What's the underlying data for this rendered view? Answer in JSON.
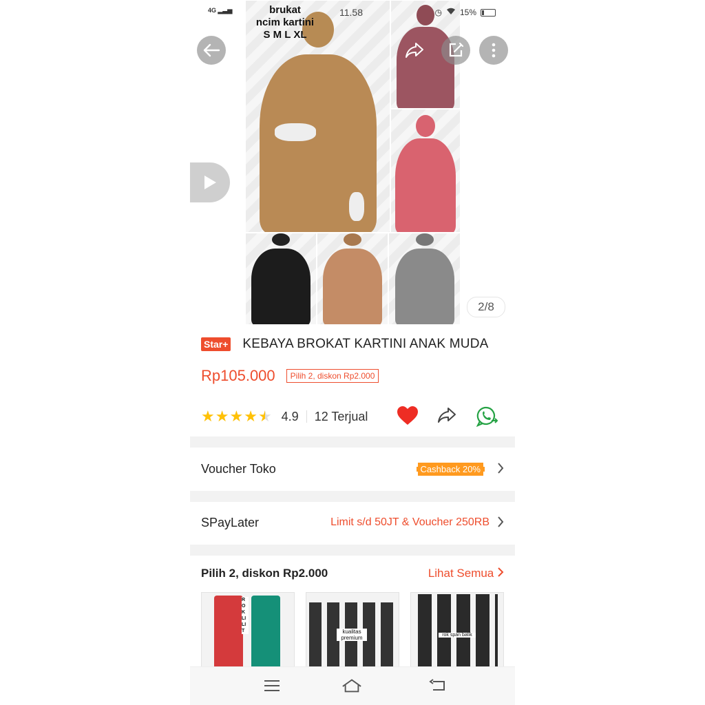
{
  "status_bar": {
    "network": "4G",
    "time": "11.58",
    "battery": "15%"
  },
  "hero": {
    "overlay_text_line1": "brukat",
    "overlay_text_line2": "ncim kartini",
    "overlay_text_line3": "S M L XL",
    "page_counter": "2/8"
  },
  "product": {
    "badge": "Star+",
    "title": "KEBAYA BROKAT KARTINI ANAK MUDA",
    "price": "Rp105.000",
    "promo_tag": "Pilih 2, diskon Rp2.000",
    "rating": "4.9",
    "rating_stars": 4.5,
    "sold": "12 Terjual"
  },
  "voucher": {
    "label": "Voucher Toko",
    "badge": "Cashback 20%"
  },
  "spaylater": {
    "label": "SPayLater",
    "value": "Limit s/d 50JT & Voucher 250RB"
  },
  "bundle": {
    "title": "Pilih 2, diskon Rp2.000",
    "link": "Lihat Semua",
    "thumbs": [
      {
        "caption": "ROK LILIT"
      },
      {
        "caption": "kualitas premium"
      },
      {
        "caption": "rok span batik"
      }
    ]
  },
  "icons": {
    "back": "arrow-left-icon",
    "share_top": "share-icon",
    "edit": "edit-icon",
    "more": "more-vertical-icon",
    "play": "play-icon",
    "heart": "heart-icon",
    "share": "share-icon",
    "whatsapp": "whatsapp-icon",
    "nav_menu": "menu-icon",
    "nav_home": "home-icon",
    "nav_back": "back-icon"
  },
  "colors": {
    "accent": "#ee4d2d",
    "star": "#ffc107",
    "whatsapp": "#25d366",
    "cashback": "#ff9a1f"
  }
}
